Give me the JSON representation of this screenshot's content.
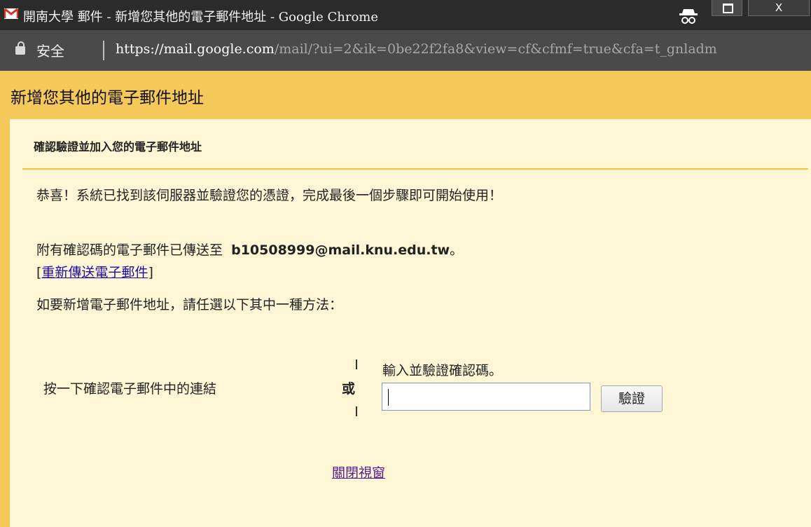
{
  "window": {
    "title": "開南大學 郵件 - 新增您其他的電子郵件地址 - Google Chrome",
    "close_glyph": "X"
  },
  "address_bar": {
    "security_label": "安全",
    "url_host": "https://mail.google.com",
    "url_rest": "/mail/?ui=2&ik=0be22f2fa8&view=cf&cfmf=true&cfa=t_gnladm"
  },
  "page": {
    "title": "新增您其他的電子郵件地址",
    "section_title": "確認驗證並加入您的電子郵件地址",
    "congrats": "恭喜！系統已找到該伺服器並驗證您的憑證，完成最後一個步驟即可開始使用！",
    "sent_prefix": "附有確認碼的電子郵件已傳送至",
    "email": "b10508999@mail.knu.edu.tw",
    "sent_suffix": "。",
    "resend_open": "[",
    "resend_label": "重新傳送電子郵件",
    "resend_close": "]",
    "instructions": "如要新增電子郵件地址，請任選以下其中一種方法：",
    "option_link": "按一下確認電子郵件中的連結",
    "or_label": "或",
    "option_code": "輸入並驗證確認碼。",
    "code_input_value": "",
    "verify_label": "驗證",
    "close_window": "關閉視窗"
  },
  "colors": {
    "accent": "#f5c85a",
    "panel": "#fff6d6",
    "divider": "#f4c23c",
    "titlebar": "#2b2b2b",
    "addressbar": "#4a4a4a"
  },
  "icons": [
    "gmail-icon",
    "incognito-icon",
    "maximize-icon",
    "close-icon",
    "lock-icon"
  ]
}
